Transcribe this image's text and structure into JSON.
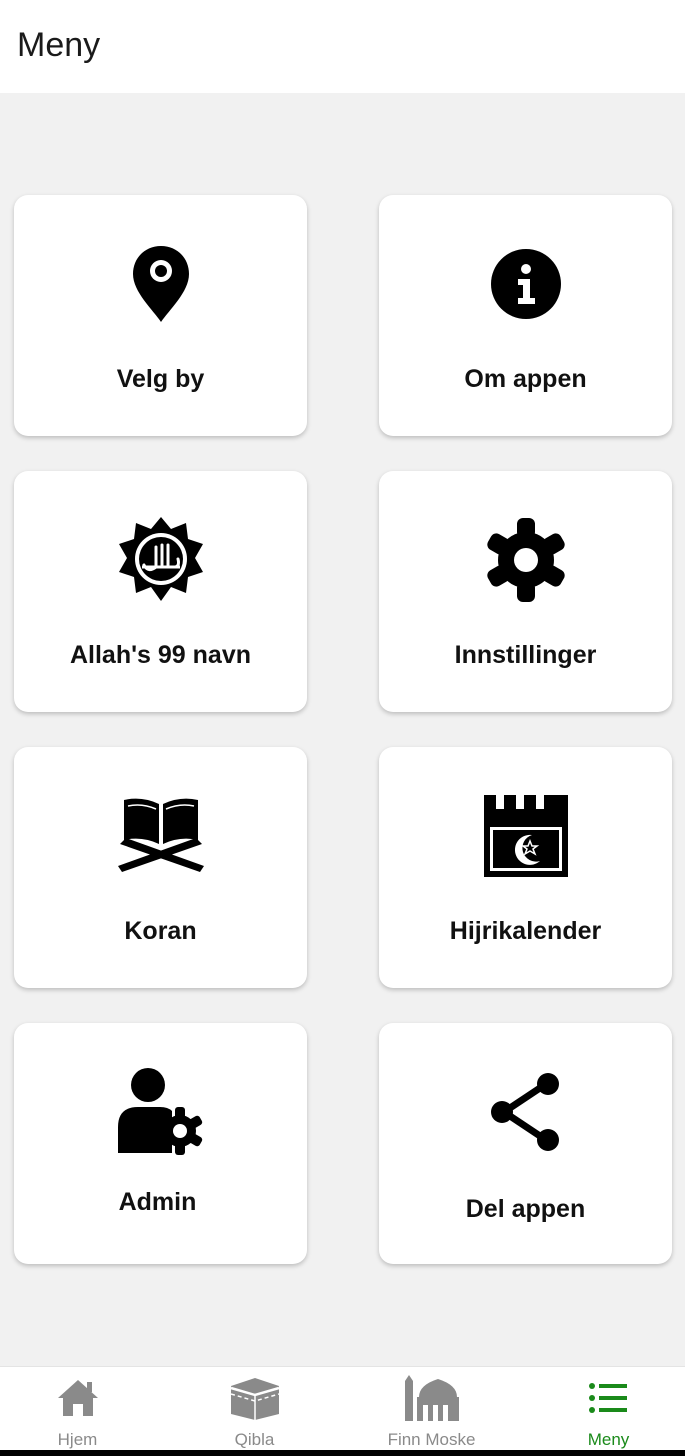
{
  "header": {
    "title": "Meny"
  },
  "menu": {
    "velg_by": "Velg by",
    "om_appen": "Om appen",
    "allah_names": "Allah's 99 navn",
    "innstillinger": "Innstillinger",
    "koran": "Koran",
    "hijrikalender": "Hijrikalender",
    "admin": "Admin",
    "del_appen": "Del appen"
  },
  "nav": {
    "items": [
      {
        "label": "Hjem",
        "icon": "home-icon"
      },
      {
        "label": "Qibla",
        "icon": "kaaba-icon"
      },
      {
        "label": "Finn Moske",
        "icon": "mosque-icon"
      },
      {
        "label": "Meny",
        "icon": "menu-list-icon",
        "active": true
      }
    ]
  },
  "colors": {
    "active": "#1a8a1a",
    "inactive": "#8a8a8a",
    "background": "#f1f1f1",
    "card": "#ffffff",
    "icon": "#000000"
  }
}
